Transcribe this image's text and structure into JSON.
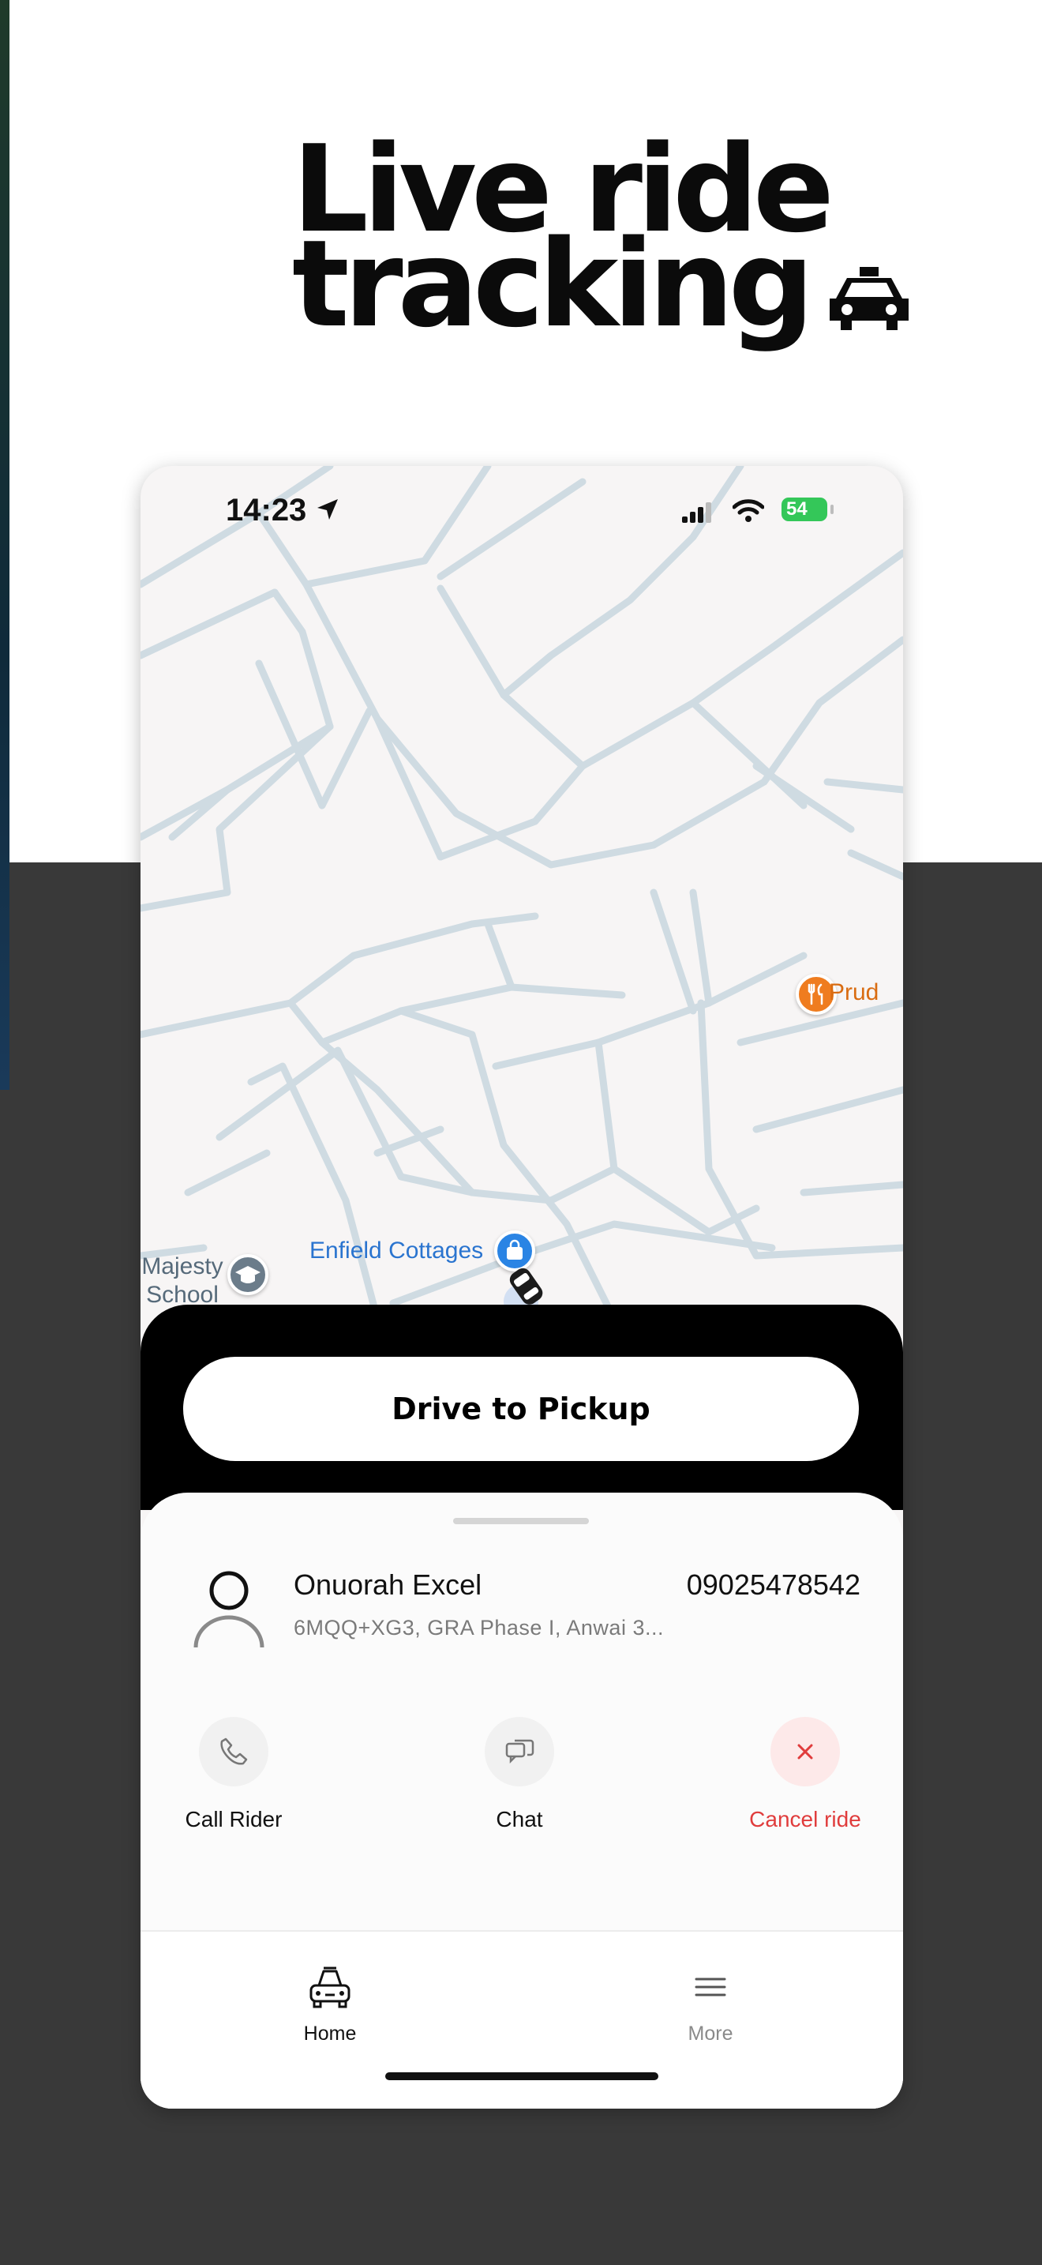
{
  "headline": {
    "line1": "Live ride",
    "line2": "tracking"
  },
  "status_bar": {
    "time": "14:23",
    "battery": "54"
  },
  "map": {
    "poi_prudent": "Prud",
    "poi_enfield": "Enfield Cottages",
    "poi_majesty_line1": "Majesty",
    "poi_majesty_line2": "School"
  },
  "primary_action": {
    "label": "Drive to Pickup"
  },
  "rider": {
    "name": "Onuorah Excel",
    "phone": "09025478542",
    "address": "6MQQ+XG3, GRA Phase I, Anwai 3..."
  },
  "actions": {
    "call_label": "Call Rider",
    "chat_label": "Chat",
    "cancel_label": "Cancel ride"
  },
  "tabbar": {
    "home_label": "Home",
    "more_label": "More"
  },
  "colors": {
    "page_dark": "#393939",
    "cancel_red": "#e03c3c",
    "poi_orange": "#ef7c1f",
    "poi_blue": "#2a84e4",
    "battery_green": "#34c759"
  },
  "icons": [
    "taxi-icon",
    "location-arrow-icon",
    "signal-icon",
    "wifi-icon",
    "battery-icon",
    "restaurant-pin-icon",
    "shopping-pin-icon",
    "school-pin-icon",
    "car-icon",
    "person-icon",
    "phone-icon",
    "chat-icon",
    "close-icon",
    "car-front-icon",
    "menu-icon"
  ]
}
